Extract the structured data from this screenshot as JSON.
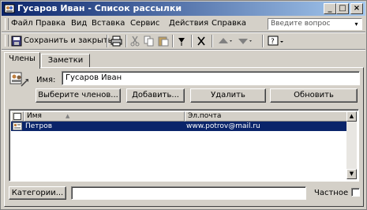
{
  "window": {
    "title": "Гусаров Иван - Список рассылки",
    "minimize_glyph": "_",
    "maximize_glyph": "□",
    "close_glyph": "×"
  },
  "menu": {
    "items": [
      "Файл",
      "Правка",
      "Вид",
      "Вставка",
      "Сервис",
      "Действия",
      "Справка"
    ],
    "help_placeholder": "Введите вопрос",
    "help_dropdown_glyph": "▾"
  },
  "toolbar": {
    "save_close_label": "Сохранить и закрыть",
    "icons": [
      "save-close-icon",
      "print-icon",
      "cut-icon",
      "copy-icon",
      "paste-icon",
      "flag-icon",
      "delete-icon",
      "move-up-icon",
      "move-down-icon",
      "help-icon"
    ]
  },
  "tabs": [
    "Члены",
    "Заметки"
  ],
  "members": {
    "name_label": "Имя:",
    "name_value": "Гусаров Иван",
    "select_members_label": "Выберите членов...",
    "add_new_label": "Добавить...",
    "remove_label": "Удалить",
    "update_label": "Обновить"
  },
  "list": {
    "columns": [
      "Имя",
      "Эл.почта"
    ],
    "sort_glyph": "▲",
    "rows": [
      {
        "name": "Петров",
        "email": "www.potrov@mail.ru"
      }
    ]
  },
  "footer": {
    "categories_label": "Категории...",
    "categories_value": "",
    "private_label": "Частное"
  },
  "colors": {
    "title_gradient_start": "#0a246a",
    "title_gradient_end": "#a6caf0",
    "selection": "#0a246a",
    "face": "#d4d0c8"
  }
}
